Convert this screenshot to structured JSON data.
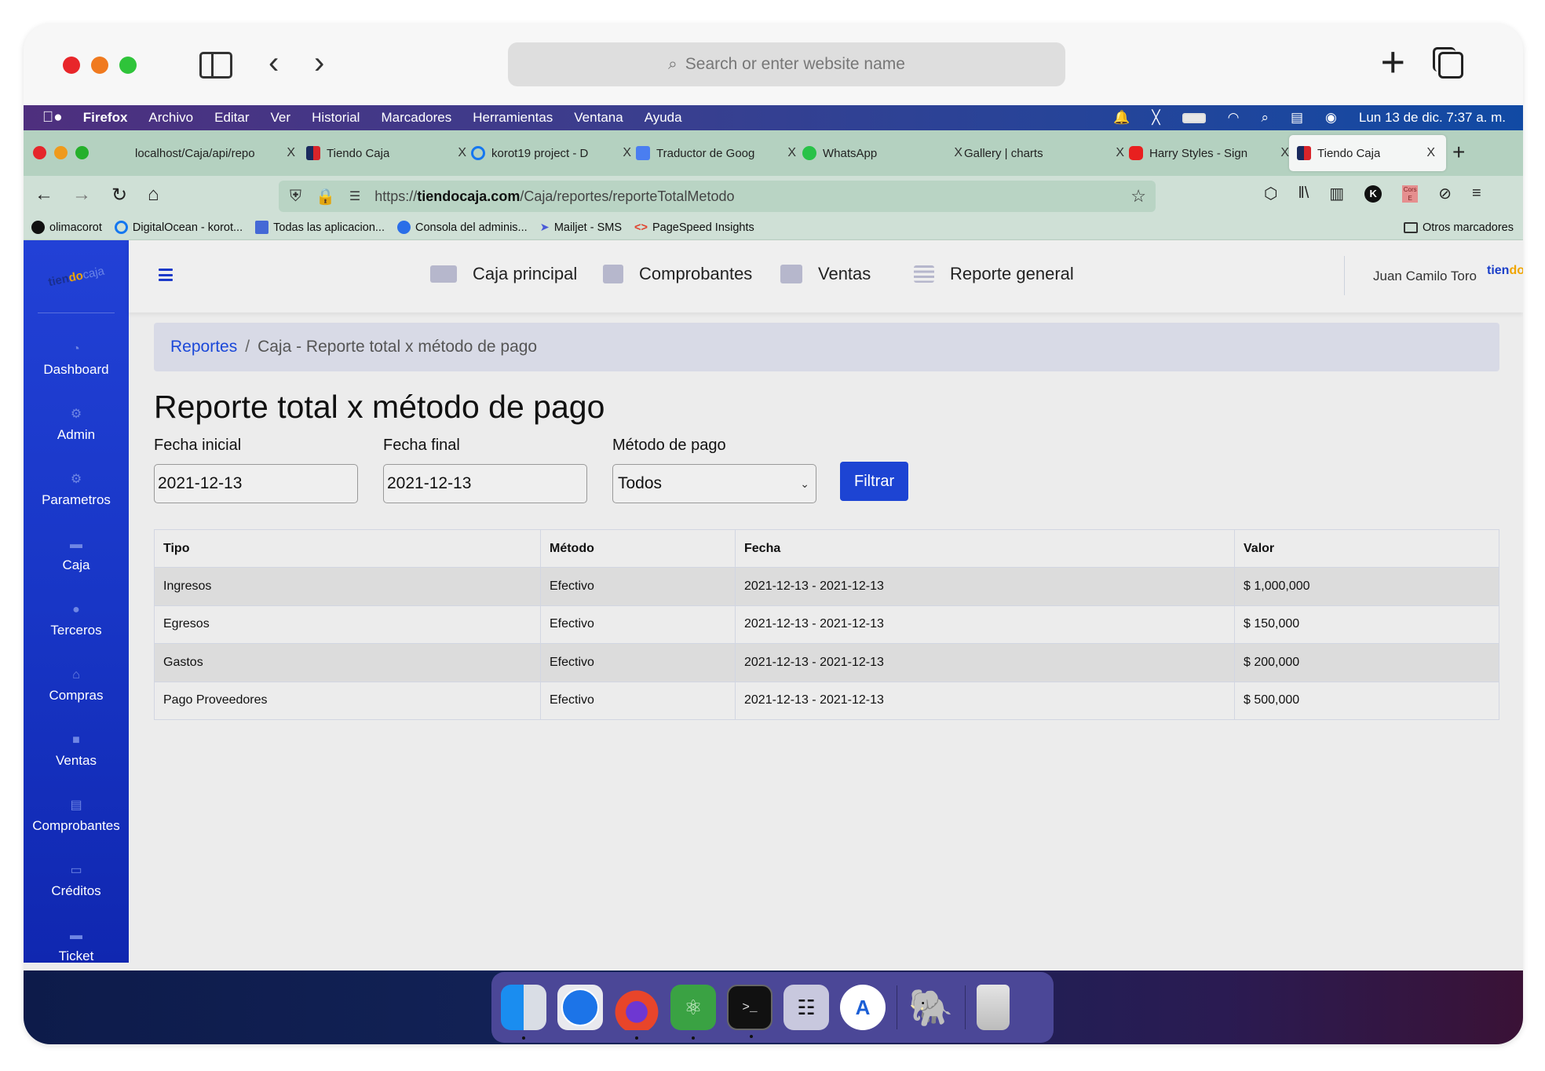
{
  "safari": {
    "search_placeholder": "Search or enter website name",
    "back_icon": "chevron-left-icon",
    "forward_icon": "chevron-right-icon",
    "new_tab_icon": "plus-icon",
    "tabs_overview_icon": "tabs-icon"
  },
  "menubar": {
    "app": "Firefox",
    "items": [
      "Archivo",
      "Editar",
      "Ver",
      "Historial",
      "Marcadores",
      "Herramientas",
      "Ventana",
      "Ayuda"
    ],
    "clock": "Lun 13 de dic.  7:37 a. m."
  },
  "firefox": {
    "tabs": [
      {
        "label": "localhost/Caja/api/repo",
        "favicon": "none",
        "active": false
      },
      {
        "label": "Tiendo Caja",
        "favicon": "tiendo-caja",
        "active": false
      },
      {
        "label": "korot19 project - D",
        "favicon": "digitalocean",
        "active": false
      },
      {
        "label": "Traductor de Goog",
        "favicon": "google-translate",
        "active": false
      },
      {
        "label": "WhatsApp",
        "favicon": "whatsapp",
        "active": false
      },
      {
        "label": "Gallery | charts",
        "favicon": "none",
        "active": false
      },
      {
        "label": "Harry Styles - Sign",
        "favicon": "youtube",
        "active": false
      },
      {
        "label": "Tiendo Caja",
        "favicon": "tiendo-caja",
        "active": true
      }
    ],
    "tab_close": "X",
    "new_tab": "+",
    "url": {
      "scheme": "https://",
      "host": "tiendocaja.com",
      "path": "/Caja/reportes/reporteTotalMetodo"
    },
    "bookmarks": [
      {
        "label": "olimacorot",
        "icon": "github"
      },
      {
        "label": "DigitalOcean - korot...",
        "icon": "digitalocean"
      },
      {
        "label": "Todas las aplicacion...",
        "icon": "app-store-connect"
      },
      {
        "label": "Consola del adminis...",
        "icon": "google-admin"
      },
      {
        "label": "Mailjet - SMS",
        "icon": "mailjet"
      },
      {
        "label": "PageSpeed Insights",
        "icon": "pagespeed"
      }
    ],
    "other_bookmarks": "Otros marcadores",
    "toolbar_badges": {
      "k": "K",
      "cors": "Cors E"
    }
  },
  "app": {
    "logo": {
      "part1": "tien",
      "part2": "do",
      "part3": " caja"
    },
    "sidebar": [
      {
        "label": "Dashboard",
        "icon": "gauge-icon"
      },
      {
        "label": "Admin",
        "icon": "gear-icon"
      },
      {
        "label": "Parametros",
        "icon": "gear-icon"
      },
      {
        "label": "Caja",
        "icon": "money-bill-icon"
      },
      {
        "label": "Terceros",
        "icon": "user-icon"
      },
      {
        "label": "Compras",
        "icon": "basket-icon"
      },
      {
        "label": "Ventas",
        "icon": "wallet-icon"
      },
      {
        "label": "Comprobantes",
        "icon": "receipt-list-icon"
      },
      {
        "label": "Créditos",
        "icon": "credit-card-icon"
      },
      {
        "label": "Ticket",
        "icon": "money-bill-icon"
      }
    ],
    "topnav": [
      {
        "label": "Caja principal",
        "icon": "money-bill-icon"
      },
      {
        "label": "Comprobantes",
        "icon": "receipt-list-icon"
      },
      {
        "label": "Ventas",
        "icon": "wallet-icon"
      },
      {
        "label": "Reporte general",
        "icon": "lines-icon"
      }
    ],
    "user_name": "Juan Camilo Toro",
    "breadcrumb": {
      "link": "Reportes",
      "separator": "/",
      "current": "Caja - Reporte total x método de pago"
    },
    "page_title": "Reporte total x método de pago",
    "filters": {
      "start_date": {
        "label": "Fecha inicial",
        "value": "2021-12-13"
      },
      "end_date": {
        "label": "Fecha final",
        "value": "2021-12-13"
      },
      "method": {
        "label": "Método de pago",
        "selected": "Todos"
      },
      "submit_label": "Filtrar"
    },
    "table": {
      "headers": [
        "Tipo",
        "Método",
        "Fecha",
        "Valor"
      ],
      "rows": [
        [
          "Ingresos",
          "Efectivo",
          "2021-12-13 - 2021-12-13",
          "$ 1,000,000"
        ],
        [
          "Egresos",
          "Efectivo",
          "2021-12-13 - 2021-12-13",
          "$ 150,000"
        ],
        [
          "Gastos",
          "Efectivo",
          "2021-12-13 - 2021-12-13",
          "$ 200,000"
        ],
        [
          "Pago Proveedores",
          "Efectivo",
          "2021-12-13 - 2021-12-13",
          "$ 500,000"
        ]
      ]
    }
  },
  "dock": [
    {
      "name": "Finder",
      "running": true
    },
    {
      "name": "Safari",
      "running": false
    },
    {
      "name": "Firefox",
      "running": true
    },
    {
      "name": "Atom",
      "running": true
    },
    {
      "name": "Terminal",
      "running": true
    },
    {
      "name": "Launchpad",
      "running": false
    },
    {
      "name": "Android Studio",
      "running": false
    },
    {
      "name": "pgAdmin",
      "running": false
    },
    {
      "name": "Trash",
      "running": false
    }
  ],
  "colors": {
    "sidebar": "#1d3ad0",
    "primary_button": "#1d44d3",
    "breadcrumb_link": "#1b48d9",
    "firefox_tabbar": "#b4d1c0",
    "menubar_start": "#4e2f7e",
    "menubar_end": "#114aa4"
  }
}
